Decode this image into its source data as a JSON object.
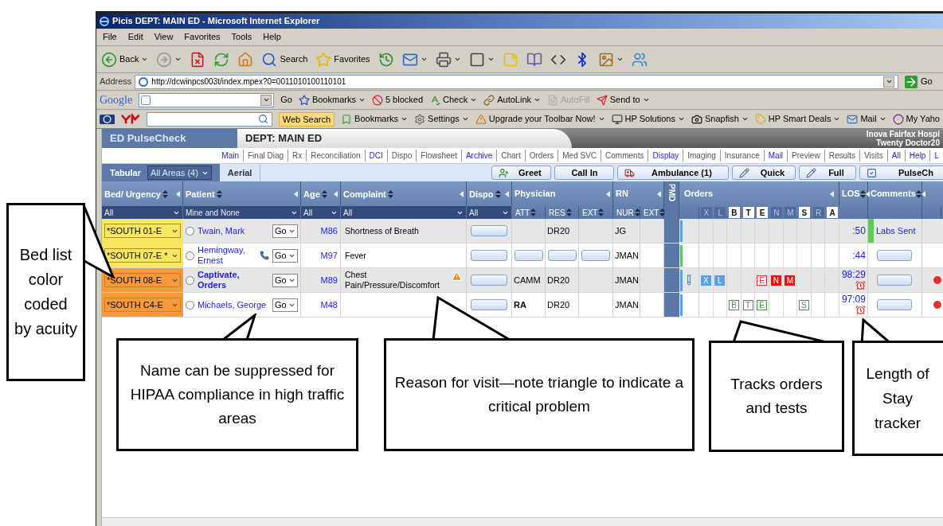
{
  "window": {
    "title": "Picis DEPT: MAIN ED - Microsoft Internet Explorer"
  },
  "menu": [
    "File",
    "Edit",
    "View",
    "Favorites",
    "Tools",
    "Help"
  ],
  "toolbar": [
    {
      "kind": "back",
      "label": "Back",
      "menu": true
    },
    {
      "kind": "forward",
      "menu": true
    },
    {
      "kind": "stop",
      "menu": false
    },
    {
      "kind": "refresh",
      "menu": false
    },
    {
      "kind": "home",
      "menu": false
    },
    {
      "kind": "search",
      "label": "Search",
      "menu": false
    },
    {
      "kind": "favorites",
      "label": "Favorites",
      "menu": false
    },
    {
      "kind": "history",
      "menu": false
    },
    {
      "kind": "mail",
      "menu": true
    },
    {
      "kind": "print",
      "menu": true
    },
    {
      "kind": "edit",
      "menu": true
    },
    {
      "kind": "note",
      "menu": false
    },
    {
      "kind": "research",
      "menu": false
    },
    {
      "kind": "window",
      "menu": false
    },
    {
      "kind": "bluetooth",
      "menu": false
    },
    {
      "kind": "image",
      "menu": true
    },
    {
      "kind": "messenger",
      "menu": false
    }
  ],
  "address": {
    "label": "Address",
    "value": "http://dcwinpcs003t/index.mpex?0=0011010100110101",
    "go": "Go"
  },
  "google_toolbar": {
    "logo": "Google",
    "go": "Go",
    "items": [
      {
        "kind": "bookmarks",
        "label": "Bookmarks",
        "menu": true,
        "disabled": false
      },
      {
        "kind": "blocked",
        "label": "5 blocked",
        "menu": false,
        "disabled": false
      },
      {
        "kind": "check",
        "label": "Check",
        "menu": true,
        "disabled": false
      },
      {
        "kind": "autolink",
        "label": "AutoLink",
        "menu": true,
        "disabled": false
      },
      {
        "kind": "autofill",
        "label": "AutoFill",
        "menu": false,
        "disabled": true
      },
      {
        "kind": "sendto",
        "label": "Send to",
        "menu": true,
        "disabled": false
      }
    ]
  },
  "yahoo_toolbar": {
    "search_button": "Web Search",
    "items": [
      {
        "kind": "bookmarks",
        "label": "Bookmarks",
        "menu": true
      },
      {
        "kind": "settings",
        "label": "Settings",
        "menu": true
      },
      {
        "kind": "upgrade",
        "label": "Upgrade your Toolbar Now!",
        "menu": true
      },
      {
        "kind": "hp",
        "label": "HP Solutions",
        "menu": true
      },
      {
        "kind": "snapfish",
        "label": "Snapfish",
        "menu": true
      },
      {
        "kind": "deals",
        "label": "HP Smart Deals",
        "menu": true
      },
      {
        "kind": "mail",
        "label": "Mail",
        "menu": true
      },
      {
        "kind": "yahoo",
        "label": "My Yaho",
        "menu": false
      }
    ]
  },
  "app": {
    "brand": "ED PulseCheck",
    "dept": "DEPT: MAIN ED",
    "hospital": "Inova Fairfax Hospi",
    "user": "Twenty Doctor20"
  },
  "nav": [
    {
      "label": "Main",
      "kind": "link"
    },
    {
      "label": "Final Diag",
      "kind": "text"
    },
    {
      "label": "Rx",
      "kind": "text"
    },
    {
      "label": "Reconciliation",
      "kind": "text"
    },
    {
      "label": "DCI",
      "kind": "link"
    },
    {
      "label": "Dispo",
      "kind": "text"
    },
    {
      "label": "Flowsheet",
      "kind": "text"
    },
    {
      "label": "Archive",
      "kind": "link"
    },
    {
      "label": "Chart",
      "kind": "text"
    },
    {
      "label": "Orders",
      "kind": "text"
    },
    {
      "label": "Med SVC",
      "kind": "text"
    },
    {
      "label": "Comments",
      "kind": "text"
    },
    {
      "label": "Display",
      "kind": "link"
    },
    {
      "label": "Imaging",
      "kind": "text"
    },
    {
      "label": "Insurance",
      "kind": "text"
    },
    {
      "label": "Mail",
      "kind": "link"
    },
    {
      "label": "Preview",
      "kind": "text"
    },
    {
      "label": "Results",
      "kind": "text"
    },
    {
      "label": "Visits",
      "kind": "text"
    },
    {
      "label": "All",
      "kind": "link"
    },
    {
      "label": "Help",
      "kind": "link"
    },
    {
      "label": "L",
      "kind": "link"
    }
  ],
  "view_tabs": [
    {
      "label": "Tabular",
      "selected": true
    },
    {
      "label": "Aerial",
      "selected": false
    }
  ],
  "area_select": "All Areas (4)",
  "actions": [
    {
      "kind": "greet",
      "label": "Greet"
    },
    {
      "kind": "callin",
      "label": "Call In"
    },
    {
      "kind": "ambulance",
      "label": "Ambulance (1)"
    },
    {
      "kind": "quick",
      "label": "Quick"
    },
    {
      "kind": "full",
      "label": "Full"
    },
    {
      "kind": "pulsecheck",
      "label": "PulseCh"
    }
  ],
  "columns": [
    {
      "kind": "filter",
      "label": "Bed/ Urgency",
      "filter": "All"
    },
    {
      "kind": "filter",
      "label": "Patient",
      "filter": "Mine and None"
    },
    {
      "kind": "filter",
      "label": "Age",
      "filter": "All"
    },
    {
      "kind": "filter",
      "label": "Complaint",
      "filter": "All"
    },
    {
      "kind": "filter",
      "label": "Dispo",
      "filter": "All"
    },
    {
      "kind": "group",
      "label": "Physician",
      "sub": [
        "ATT",
        "RES",
        "EXT"
      ]
    },
    {
      "kind": "group",
      "label": "RN",
      "sub": [
        "NUR",
        "EXT"
      ]
    },
    {
      "kind": "vertical",
      "label": "PMD"
    },
    {
      "kind": "orders",
      "label": "Orders",
      "letters": [
        {
          "text": "X",
          "active": false
        },
        {
          "text": "L",
          "active": false
        },
        {
          "text": "B",
          "active": true
        },
        {
          "text": "T",
          "active": true
        },
        {
          "text": "E",
          "active": true
        },
        {
          "text": "N",
          "active": false
        },
        {
          "text": "M",
          "active": false
        },
        {
          "text": "S",
          "active": true
        },
        {
          "text": "R",
          "active": false
        },
        {
          "text": "A",
          "active": true
        }
      ]
    },
    {
      "kind": "plain",
      "label": "LOS"
    },
    {
      "kind": "plain",
      "label": "Comments"
    },
    {
      "kind": "cut"
    }
  ],
  "rows": [
    {
      "bed": "*SOUTH 01-E",
      "acuity": {
        "color": "#f7e760"
      },
      "selected": false,
      "patient": "Twain, Mark",
      "bold": false,
      "phone": false,
      "go": "Go",
      "age": "M86",
      "complaint": "Shortness of Breath",
      "critical": false,
      "cells": [
        {
          "kind": "button"
        },
        {
          "kind": "empty"
        },
        {
          "kind": "text",
          "text": "DR20",
          "bold": false
        },
        {
          "kind": "empty"
        },
        {
          "kind": "text",
          "text": "JG",
          "bold": false
        },
        {
          "kind": "empty"
        }
      ],
      "strip": {
        "color": "#5aa0e8"
      },
      "specimen": false,
      "orders": [
        {
          "kind": "blank"
        },
        {
          "kind": "blank"
        },
        {
          "kind": "blank"
        },
        {
          "kind": "blank"
        },
        {
          "kind": "blank"
        },
        {
          "kind": "blank"
        },
        {
          "kind": "blank"
        },
        {
          "kind": "blank"
        },
        {
          "kind": "blank"
        },
        {
          "kind": "blank"
        }
      ],
      "los": ":50",
      "overdue": false,
      "comment": {
        "kind": "text",
        "text": "Labs Sent",
        "color": "#5ccb5c"
      },
      "alert": false
    },
    {
      "bed": "*SOUTH 07-E *",
      "acuity": {
        "color": "#f7e760"
      },
      "selected": false,
      "patient": "Hemingway, Ernest",
      "bold": false,
      "phone": true,
      "go": "Go",
      "age": "M97",
      "complaint": "Fever",
      "critical": false,
      "cells": [
        {
          "kind": "button"
        },
        {
          "kind": "button"
        },
        {
          "kind": "button"
        },
        {
          "kind": "button"
        },
        {
          "kind": "text",
          "text": "JMAN",
          "bold": false
        },
        {
          "kind": "empty"
        }
      ],
      "strip": {
        "color": "#5cc85c"
      },
      "specimen": false,
      "orders": [
        {
          "kind": "blank"
        },
        {
          "kind": "blank"
        },
        {
          "kind": "blank"
        },
        {
          "kind": "blank"
        },
        {
          "kind": "blank"
        },
        {
          "kind": "blank"
        },
        {
          "kind": "blank"
        },
        {
          "kind": "blank"
        },
        {
          "kind": "blank"
        },
        {
          "kind": "blank"
        }
      ],
      "los": ":44",
      "overdue": false,
      "comment": {
        "kind": "button"
      },
      "alert": false
    },
    {
      "bed": "*SOUTH 08-E",
      "acuity": {
        "color": "#f7993b"
      },
      "selected": false,
      "patient": "Captivate, Orders",
      "bold": true,
      "phone": false,
      "go": "Go",
      "age": "M89",
      "complaint": "Chest Pain/Pressure/Discomfort",
      "critical": true,
      "cells": [
        {
          "kind": "button"
        },
        {
          "kind": "text",
          "text": "CAMM",
          "bold": false
        },
        {
          "kind": "text",
          "text": "DR20",
          "bold": false
        },
        {
          "kind": "empty"
        },
        {
          "kind": "text",
          "text": "JMAN",
          "bold": false
        },
        {
          "kind": "empty"
        }
      ],
      "strip": {
        "color": "#5aa0e8"
      },
      "specimen": true,
      "orders": [
        {
          "kind": "filled",
          "text": "X",
          "color": "#5aa0e8"
        },
        {
          "kind": "filled",
          "text": "L",
          "color": "#5aa0e8"
        },
        {
          "kind": "blank"
        },
        {
          "kind": "blank"
        },
        {
          "kind": "outline",
          "text": "E",
          "color": "#e03030"
        },
        {
          "kind": "filled",
          "text": "N",
          "color": "#e81010"
        },
        {
          "kind": "filled",
          "text": "M",
          "color": "#e81010"
        },
        {
          "kind": "blank"
        },
        {
          "kind": "blank"
        },
        {
          "kind": "blank"
        }
      ],
      "los": "98:29",
      "overdue": true,
      "comment": {
        "kind": "button"
      },
      "alert": true
    },
    {
      "bed": "*SOUTH C4-E",
      "acuity": {
        "color": "#f7993b"
      },
      "selected": false,
      "patient": "Michaels, George",
      "bold": false,
      "phone": false,
      "go": "Go",
      "age": "M48",
      "critical": false,
      "cells": [
        {
          "kind": "button"
        },
        {
          "kind": "text",
          "text": "RA",
          "bold": true
        },
        {
          "kind": "text",
          "text": "DR20",
          "bold": false
        },
        {
          "kind": "empty"
        },
        {
          "kind": "text",
          "text": "JMAN",
          "bold": false
        },
        {
          "kind": "empty"
        }
      ],
      "strip": {
        "color": "#5aa0e8"
      },
      "specimen": false,
      "orders": [
        {
          "kind": "blank"
        },
        {
          "kind": "blank"
        },
        {
          "kind": "outline",
          "text": "B",
          "color": "#3a9a3a"
        },
        {
          "kind": "outline",
          "text": "T",
          "color": "#3a9a3a"
        },
        {
          "kind": "outline",
          "text": "E",
          "color": "#3a9a3a"
        },
        {
          "kind": "blank"
        },
        {
          "kind": "blank"
        },
        {
          "kind": "outline",
          "text": "S",
          "color": "#3a9a3a"
        },
        {
          "kind": "blank"
        },
        {
          "kind": "blank"
        }
      ],
      "los": "97:09",
      "overdue": true,
      "comment": {
        "kind": "button"
      },
      "alert": true
    }
  ],
  "callouts": [
    {
      "text": "Bed list color coded by acuity"
    },
    {
      "text": "Name can be suppressed for HIPAA compliance in high traffic areas"
    },
    {
      "text": "Reason for visit—note triangle to indicate a critical problem"
    },
    {
      "text": "Tracks orders and tests"
    },
    {
      "text": "Length of Stay tracker"
    }
  ]
}
